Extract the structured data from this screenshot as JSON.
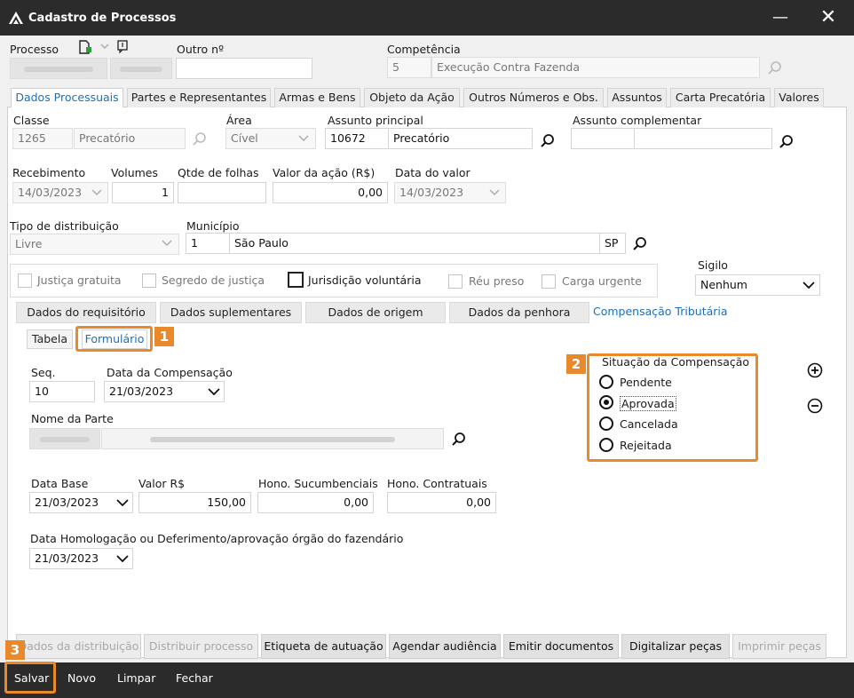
{
  "window": {
    "title": "Cadastro de Processos",
    "minimize_glyph": "—",
    "close_glyph": "✕"
  },
  "header": {
    "processo_label": "Processo",
    "outro_label": "Outro nº",
    "competencia_label": "Competência",
    "competencia_code": "5",
    "competencia_value": "Execução Contra Fazenda"
  },
  "tabs": [
    {
      "label": "Dados Processuais",
      "active": true
    },
    {
      "label": "Partes e Representantes"
    },
    {
      "label": "Armas e Bens"
    },
    {
      "label": "Objeto da Ação"
    },
    {
      "label": "Outros Números e Obs."
    },
    {
      "label": "Assuntos"
    },
    {
      "label": "Carta Precatória"
    },
    {
      "label": "Valores"
    }
  ],
  "form": {
    "classe_label": "Classe",
    "classe_code": "1265",
    "classe_value": "Precatório",
    "area_label": "Área",
    "area_value": "Cível",
    "assunto_label": "Assunto principal",
    "assunto_code": "10672",
    "assunto_value": "Precatório",
    "assunto_comp_label": "Assunto complementar",
    "recebimento_label": "Recebimento",
    "recebimento_value": "14/03/2023",
    "volumes_label": "Volumes",
    "volumes_value": "1",
    "folhas_label": "Qtde de folhas",
    "valor_acao_label": "Valor da ação (R$)",
    "valor_acao_value": "0,00",
    "data_valor_label": "Data do valor",
    "data_valor_value": "14/03/2023",
    "distribuicao_label": "Tipo de distribuição",
    "distribuicao_value": "Livre",
    "municipio_label": "Município",
    "municipio_code": "1",
    "municipio_value": "São Paulo",
    "municipio_uf": "SP",
    "checkboxes": [
      "Justiça gratuita",
      "Segredo de justiça",
      "Jurisdição voluntária",
      "Réu preso",
      "Carga urgente"
    ],
    "sigilo_label": "Sigilo",
    "sigilo_value": "Nenhum"
  },
  "subtabs": [
    {
      "label": "Dados do requisitório"
    },
    {
      "label": "Dados suplementares"
    },
    {
      "label": "Dados de origem"
    },
    {
      "label": "Dados da penhora"
    },
    {
      "label": "Compensação Tributária",
      "active": true
    }
  ],
  "viewtabs": [
    {
      "label": "Tabela"
    },
    {
      "label": "Formulário",
      "active": true
    }
  ],
  "comp": {
    "seq_label": "Seq.",
    "seq_value": "10",
    "data_comp_label": "Data da Compensação",
    "data_comp_value": "21/03/2023",
    "nome_parte_label": "Nome da Parte",
    "data_base_label": "Data Base",
    "data_base_value": "21/03/2023",
    "valor_label": "Valor R$",
    "valor_value": "150,00",
    "hono_suc_label": "Hono. Sucumbenciais",
    "hono_suc_value": "0,00",
    "hono_con_label": "Hono. Contratuais",
    "hono_con_value": "0,00",
    "homolog_label": "Data Homologação ou Deferimento/aprovação órgão do fazendário",
    "homolog_value": "21/03/2023",
    "situacao_label": "Situação da Compensação",
    "situacao_options": [
      "Pendente",
      "Aprovada",
      "Cancelada",
      "Rejeitada"
    ],
    "situacao_selected": "Aprovada"
  },
  "badges": [
    "1",
    "2",
    "3"
  ],
  "actions": [
    {
      "label": "Dados da distribuição",
      "enabled": false
    },
    {
      "label": "Distribuir processo",
      "enabled": false
    },
    {
      "label": "Etiqueta de autuação",
      "enabled": true
    },
    {
      "label": "Agendar audiência",
      "enabled": true
    },
    {
      "label": "Emitir documentos",
      "enabled": true
    },
    {
      "label": "Digitalizar peças",
      "enabled": true
    },
    {
      "label": "Imprimir peças",
      "enabled": false
    }
  ],
  "menu": [
    "Salvar",
    "Novo",
    "Limpar",
    "Fechar"
  ],
  "colors": {
    "accent": "#1d6fb8",
    "highlight": "#e8892b",
    "titlebar": "#2b2b2b"
  }
}
